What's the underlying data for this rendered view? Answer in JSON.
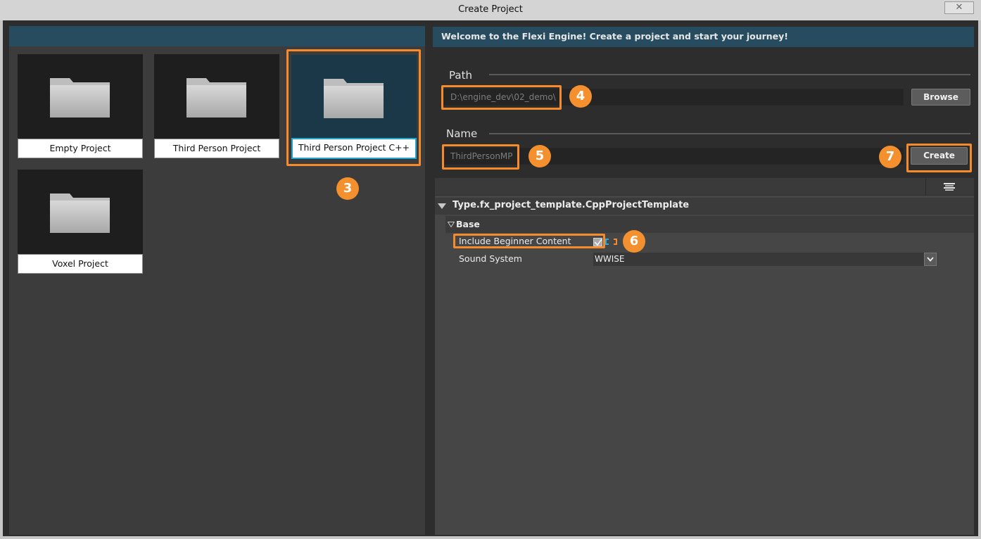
{
  "window": {
    "title": "Create Project",
    "close_label": "✕"
  },
  "templates": {
    "items": [
      {
        "label": "Empty Project"
      },
      {
        "label": "Third Person Project"
      },
      {
        "label": "Third Person Project C++",
        "selected": true
      },
      {
        "label": "Voxel Project"
      }
    ]
  },
  "welcome": {
    "text": "Welcome to the Flexi Engine! Create a project and start your journey!"
  },
  "path": {
    "label": "Path",
    "value": "D:\\engine_dev\\02_demo\\",
    "browse_label": "Browse"
  },
  "name": {
    "label": "Name",
    "value": "ThirdPersonMP",
    "create_label": "Create"
  },
  "properties": {
    "root_label": "Type.fx_project_template.CppProjectTemplate",
    "group_label": "Base",
    "include_label": "Include Beginner Content",
    "include_checked": true,
    "sound_label": "Sound System",
    "sound_value": "WWISE"
  },
  "annotations": {
    "step3": "3",
    "step4": "4",
    "step5": "5",
    "step6": "6",
    "step7": "7",
    "color": "#f58b2a"
  }
}
